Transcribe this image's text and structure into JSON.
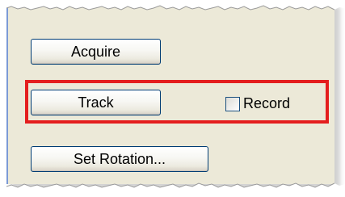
{
  "buttons": {
    "acquire": "Acquire",
    "track": "Track",
    "set_rotation": "Set Rotation..."
  },
  "record_checkbox": {
    "label": "Record",
    "checked": false
  },
  "colors": {
    "panel": "#ece9d8",
    "highlight": "#e41e1e",
    "button_border": "#003c74"
  }
}
